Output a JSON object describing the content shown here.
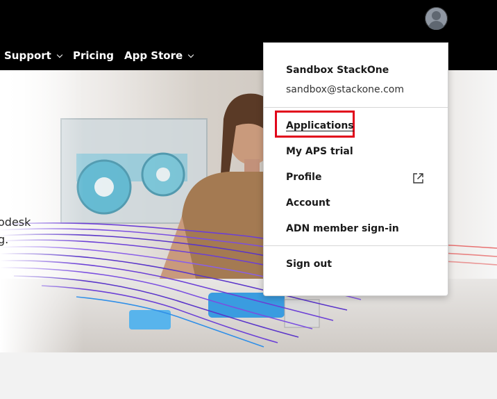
{
  "nav": {
    "items": [
      {
        "label": "Support",
        "has_dropdown": true
      },
      {
        "label": "Pricing",
        "has_dropdown": false
      },
      {
        "label": "App Store",
        "has_dropdown": true
      }
    ]
  },
  "hero": {
    "text_line1": "odesk",
    "text_line2": "g."
  },
  "account_menu": {
    "user_name": "Sandbox StackOne",
    "user_email": "sandbox@stackone.com",
    "items": [
      {
        "label": "Applications",
        "highlighted": true
      },
      {
        "label": "My APS trial"
      },
      {
        "label": "Profile",
        "icon": "external-link-icon"
      },
      {
        "label": "Account"
      },
      {
        "label": "ADN member sign-in"
      }
    ],
    "sign_out": "Sign out"
  },
  "colors": {
    "topbar_bg": "#000000",
    "highlight_border": "#e1061b",
    "flow_purple": "#6b3fd6",
    "flow_blue": "#2f8fe8",
    "flow_red": "#e23b3b"
  }
}
